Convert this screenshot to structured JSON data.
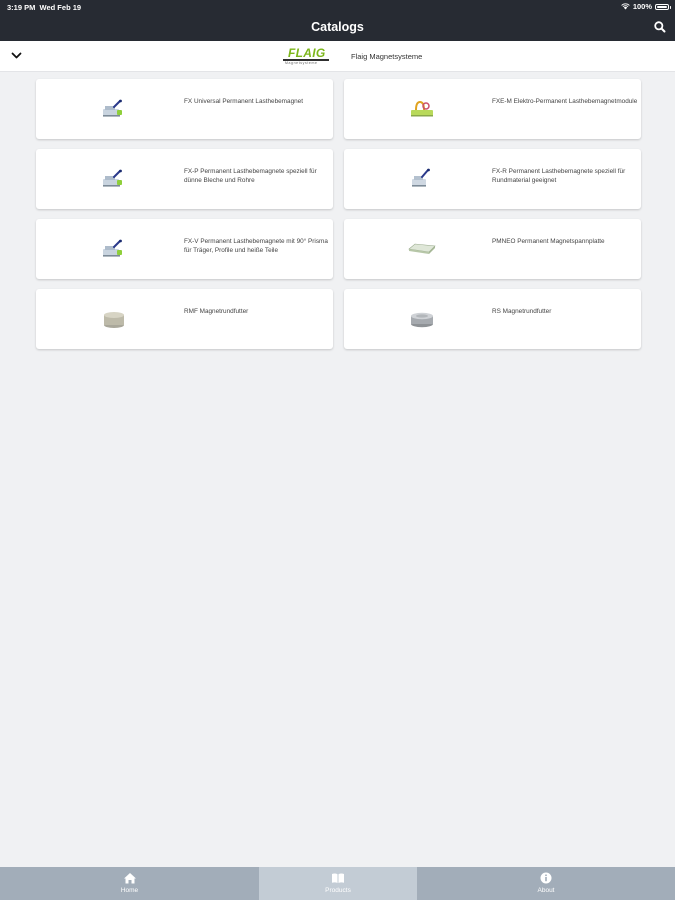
{
  "status_bar": {
    "time": "3:19 PM",
    "date": "Wed Feb 19",
    "battery": "100%"
  },
  "header": {
    "title": "Catalogs",
    "search_icon": "search-icon"
  },
  "subheader": {
    "collapse_icon": "chevron-down-icon",
    "brand_logo_text": "FLAIG",
    "brand_logo_subtext": "Magnetsysteme",
    "supplier_name": "Flaig Magnetsysteme"
  },
  "catalogs": [
    {
      "label": "FX Universal Permanent Lasthebemagnet",
      "icon": "lifting-magnet-image"
    },
    {
      "label": "FXE-M Elektro-Permanent Lasthebemagnetmodule",
      "icon": "electro-permanent-module-image"
    },
    {
      "label": "FX-P Permanent Lasthebemagnete speziell für dünne Bleche und Rohre",
      "icon": "lifting-magnet-image"
    },
    {
      "label": "FX-R Permanent Lasthebemagnete speziell für Rundmaterial geeignet",
      "icon": "lifting-magnet-image"
    },
    {
      "label": "FX-V Permanent Lasthebemagnete mit 90° Prisma für Träger, Profile und heiße Teile",
      "icon": "lifting-magnet-image"
    },
    {
      "label": "PMNEO Permanent Magnetspannplatte",
      "icon": "magnetic-chuck-plate-image"
    },
    {
      "label": "RMF Magnetrundfutter",
      "icon": "round-chuck-image"
    },
    {
      "label": "RS Magnetrundfutter",
      "icon": "round-chuck-image"
    }
  ],
  "tabbar": {
    "tabs": [
      {
        "label": "Home",
        "icon": "home-icon",
        "active": false
      },
      {
        "label": "Products",
        "icon": "book-icon",
        "active": true
      },
      {
        "label": "About",
        "icon": "info-icon",
        "active": false
      }
    ]
  },
  "colors": {
    "header_bg": "#272b33",
    "page_bg": "#f0f1f3",
    "brand_green": "#7cb61b",
    "tabbar_bg": "#a2adb9",
    "tabbar_active_bg": "#c3ccd5"
  }
}
